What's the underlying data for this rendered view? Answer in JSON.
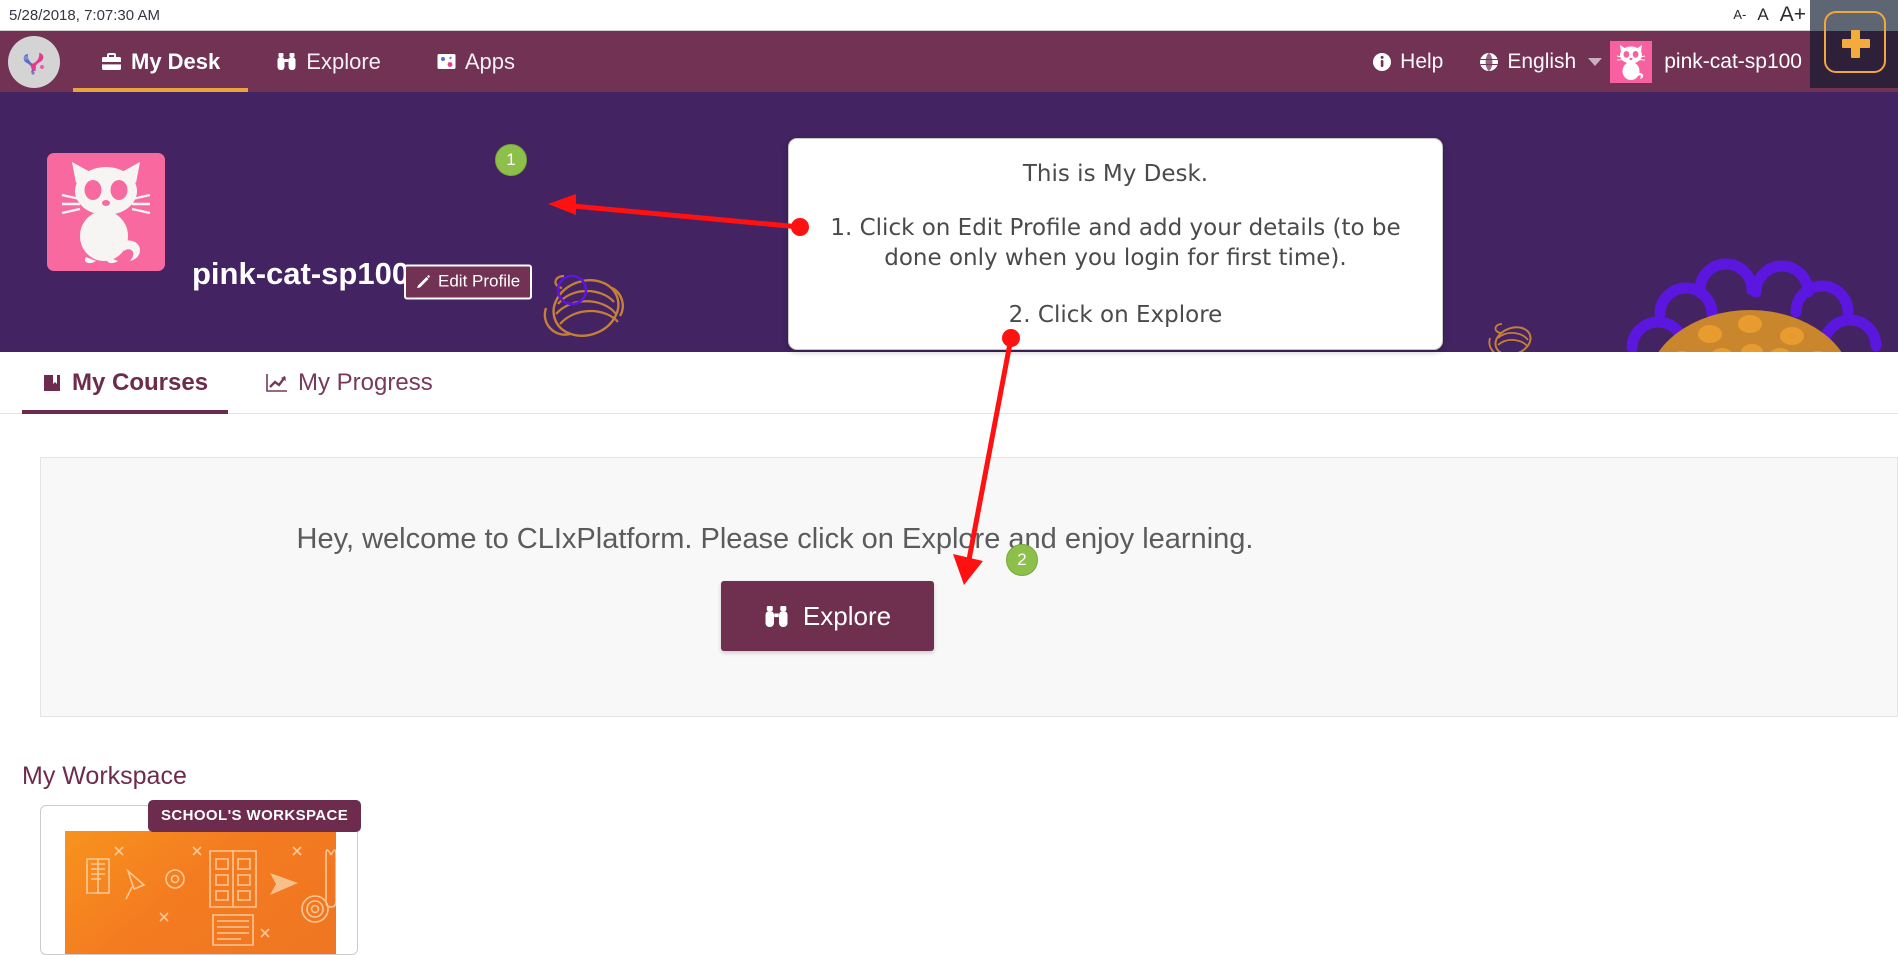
{
  "browser_strip": {
    "datetime": "5/28/2018, 7:07:30 AM",
    "font_size_controls": {
      "decrease": "A-",
      "normal": "A",
      "increase": "A+"
    }
  },
  "corner_panel": {
    "add_button_label": "+",
    "add_button_name": "plus-icon",
    "panel_color": "#2e2039",
    "accent_color": "#f5ab3a"
  },
  "navbar": {
    "brand_icon": "clix-logo-icon",
    "background_color": "#723253",
    "active_underline_color": "#e9a33c",
    "left_items": [
      {
        "label": "My Desk",
        "icon": "briefcase-icon",
        "active": true
      },
      {
        "label": "Explore",
        "icon": "binoculars-icon",
        "active": false
      },
      {
        "label": "Apps",
        "icon": "apps-image-icon",
        "active": false
      }
    ],
    "right_items": [
      {
        "label": "Help",
        "icon": "info-circle-icon"
      },
      {
        "label": "English",
        "icon": "globe-icon"
      }
    ],
    "language_caret": "chevron-down-icon",
    "user": {
      "name": "pink-cat-sp100",
      "avatar": "pink-cat-avatar"
    }
  },
  "banner": {
    "background_color": "#432361",
    "profile_name": "pink-cat-sp100",
    "avatar": "pink-cat-avatar-large",
    "edit_profile": {
      "label": "Edit Profile",
      "icon": "pencil-icon"
    },
    "decor": {
      "yarn_color": "#c4803a",
      "flower_petal_color": "#5b16e0",
      "flower_center_color": "#c9862c"
    }
  },
  "step_badges": [
    {
      "number": "1"
    },
    {
      "number": "2"
    }
  ],
  "callout": {
    "title": "This is My Desk.",
    "line_1": "1. Click on Edit Profile and add your details (to be done only when you login for first time).",
    "line_2": "2. Click on Explore"
  },
  "tabs": [
    {
      "label": "My Courses",
      "icon": "book-icon",
      "active": true
    },
    {
      "label": "My Progress",
      "icon": "chart-line-icon",
      "active": false
    }
  ],
  "welcome": {
    "message": "Hey, welcome to CLIxPlatform. Please click on Explore and enjoy learning.",
    "explore_button": {
      "label": "Explore",
      "icon": "binoculars-icon"
    }
  },
  "workspace": {
    "section_title": "My Workspace",
    "cards": [
      {
        "ribbon": "SCHOOL'S WORKSPACE",
        "thumb": "orange-learning-illustration"
      }
    ]
  },
  "annotation_arrows": {
    "color": "#ff1111",
    "count": 2
  }
}
